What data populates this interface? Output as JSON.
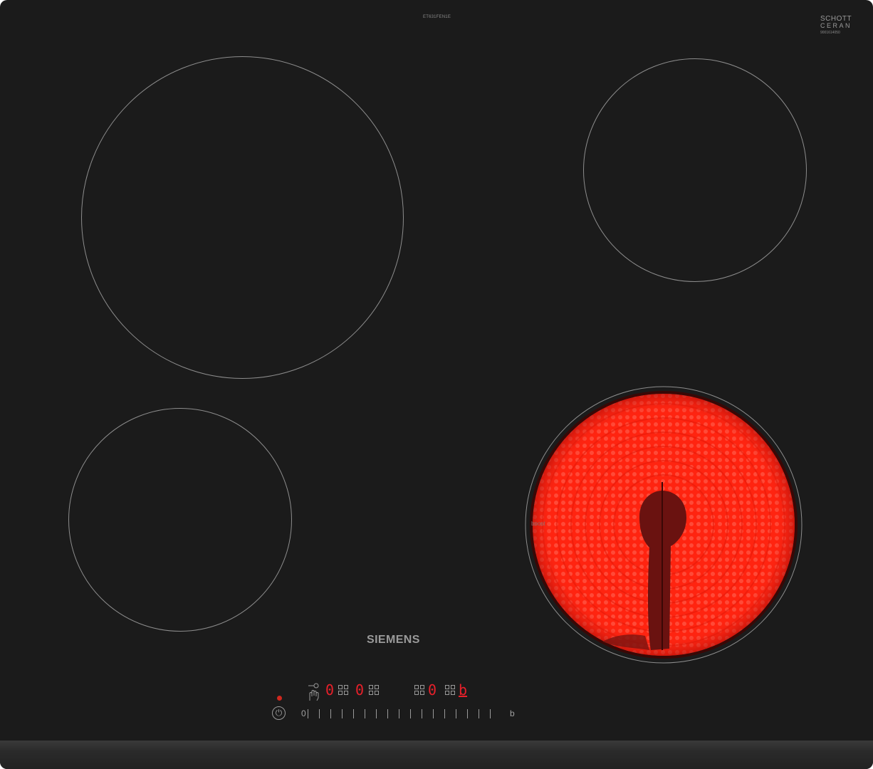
{
  "product": {
    "model": "ET631FEN1E",
    "brand": "SIEMENS",
    "glass_brand_line1": "SCHOTT",
    "glass_brand_line2": "CERAN",
    "serial": "9001614050"
  },
  "zones": [
    {
      "name": "rear-left",
      "state": "off"
    },
    {
      "name": "rear-right",
      "state": "off"
    },
    {
      "name": "front-left",
      "state": "off"
    },
    {
      "name": "front-right",
      "state": "on",
      "glow_color": "#ff2a1a"
    }
  ],
  "front_right_label": "boost",
  "display": {
    "zone1_level": "0",
    "zone2_level": "0",
    "zone3_level": "0",
    "zone4_level": "b"
  },
  "controls": {
    "power_icon": "power-icon",
    "slider_min": "0",
    "slider_max": "b",
    "slider_ticks": 17,
    "indicator_color": "#d0281e"
  }
}
